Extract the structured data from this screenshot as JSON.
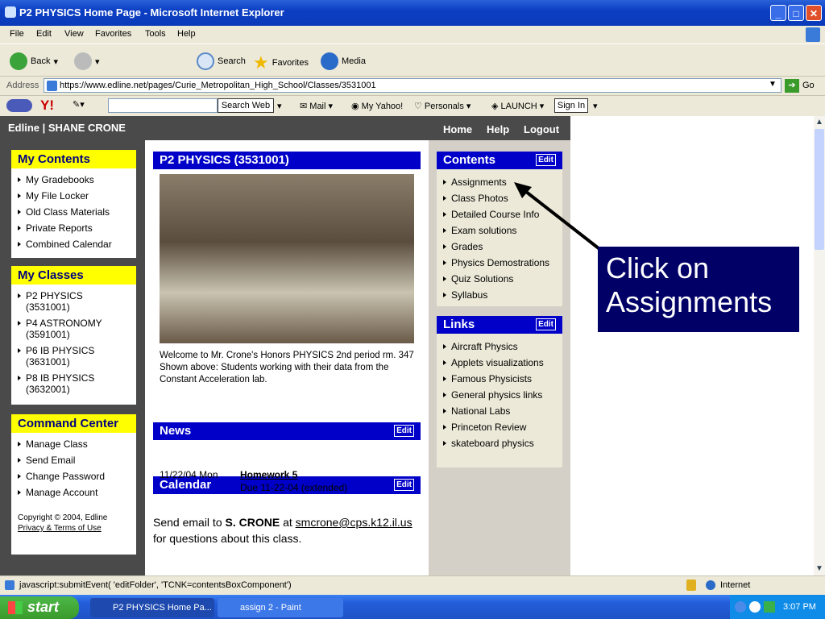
{
  "window": {
    "title": "P2 PHYSICS Home Page - Microsoft Internet Explorer"
  },
  "menu": [
    "File",
    "Edit",
    "View",
    "Favorites",
    "Tools",
    "Help"
  ],
  "toolbar": {
    "back": "Back",
    "search": "Search",
    "favorites": "Favorites",
    "media": "Media"
  },
  "address": {
    "label": "Address",
    "url": "https://www.edline.net/pages/Curie_Metropolitan_High_School/Classes/3531001",
    "go": "Go"
  },
  "yahoo": {
    "search_web": "Search Web",
    "mail": "Mail",
    "my_yahoo": "My Yahoo!",
    "personals": "Personals",
    "launch": "LAUNCH",
    "sign_in": "Sign In"
  },
  "header": {
    "brand": "Edline",
    "user": "SHANE CRONE",
    "home": "Home",
    "help": "Help",
    "logout": "Logout"
  },
  "my_contents": {
    "title": "My Contents",
    "items": [
      "My Gradebooks",
      "My File Locker",
      "Old Class Materials",
      "Private Reports",
      "Combined Calendar"
    ]
  },
  "my_classes": {
    "title": "My Classes",
    "items": [
      "P2 PHYSICS (3531001)",
      "P4 ASTRONOMY (3591001)",
      "P6 IB PHYSICS (3631001)",
      "P8 IB PHYSICS (3632001)"
    ]
  },
  "command_center": {
    "title": "Command Center",
    "items": [
      "Manage Class",
      "Send Email",
      "Change Password",
      "Manage Account"
    ]
  },
  "copyright": {
    "text": "Copyright © 2004, Edline",
    "link": "Privacy & Terms of Use"
  },
  "main": {
    "title": "P2 PHYSICS (3531001)",
    "caption": "Welcome to Mr. Crone's Honors PHYSICS 2nd period rm. 347 Shown above: Students working with their data from the Constant Acceleration lab.",
    "news_title": "News",
    "calendar_title": "Calendar",
    "edit": "Edit",
    "calendar_date": "11/22/04 Mon",
    "calendar_item": "Homework 5",
    "calendar_due": "Due 11-22-04 (extended)",
    "email_prefix": "Send email to",
    "email_name": "S. CRONE",
    "email_at": "at",
    "email_address": "smcrone@cps.k12.il.us",
    "email_suffix": "for questions about this class."
  },
  "contents": {
    "title": "Contents",
    "items": [
      "Assignments",
      "Class Photos",
      "Detailed Course Info",
      "Exam solutions",
      "Grades",
      "Physics Demostrations",
      "Quiz Solutions",
      "Syllabus"
    ]
  },
  "links": {
    "title": "Links",
    "items": [
      "Aircraft Physics",
      "Applets visualizations",
      "Famous Physicists",
      "General physics links",
      "National Labs",
      "Princeton Review",
      "skateboard physics"
    ]
  },
  "callout": {
    "text": "Click on Assignments"
  },
  "status": {
    "text": "javascript:submitEvent( 'editFolder', 'TCNK=contentsBoxComponent')",
    "zone": "Internet"
  },
  "taskbar": {
    "start": "start",
    "task1": "P2 PHYSICS Home Pa...",
    "task2": "assign 2 - Paint",
    "clock": "3:07 PM"
  }
}
